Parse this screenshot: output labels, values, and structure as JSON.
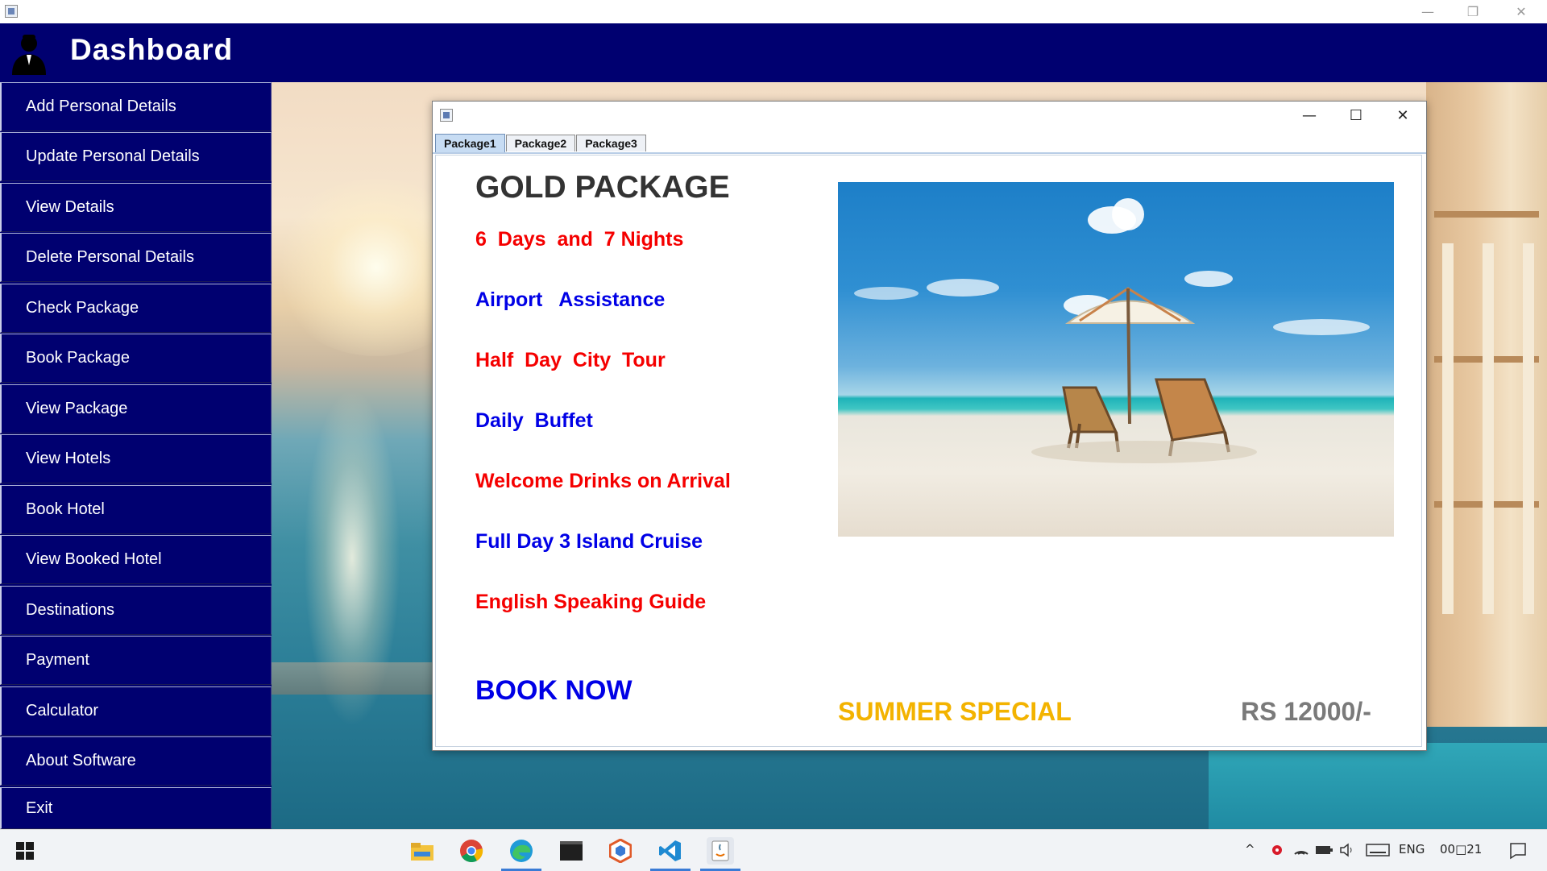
{
  "window": {
    "controls": {
      "minimize": "—",
      "restore": "❐",
      "close": "✕"
    }
  },
  "header": {
    "title": "Dashboard",
    "avatar_icon": "user-avatar-icon"
  },
  "sidebar": {
    "items": [
      {
        "label": "Add Personal Details"
      },
      {
        "label": "Update Personal Details"
      },
      {
        "label": "View Details"
      },
      {
        "label": "Delete Personal Details"
      },
      {
        "label": "Check Package"
      },
      {
        "label": "Book Package"
      },
      {
        "label": "View Package"
      },
      {
        "label": "View Hotels"
      },
      {
        "label": "Book Hotel"
      },
      {
        "label": "View Booked Hotel"
      },
      {
        "label": "Destinations"
      },
      {
        "label": "Payment"
      },
      {
        "label": "Calculator"
      },
      {
        "label": "About Software"
      },
      {
        "label": "Exit"
      }
    ],
    "bg_color": "#000070"
  },
  "package_window": {
    "controls": {
      "minimize": "—",
      "maximize": "☐",
      "close": "✕"
    },
    "tabs": [
      {
        "label": "Package1",
        "active": true
      },
      {
        "label": "Package2",
        "active": false
      },
      {
        "label": "Package3",
        "active": false
      }
    ],
    "title": "GOLD PACKAGE",
    "features": [
      {
        "text": "6  Days  and  7 Nights",
        "color": "red"
      },
      {
        "text": "Airport   Assistance",
        "color": "blue"
      },
      {
        "text": "Half  Day  City  Tour",
        "color": "red"
      },
      {
        "text": "Daily  Buffet",
        "color": "blue"
      },
      {
        "text": "Welcome Drinks on Arrival",
        "color": "red"
      },
      {
        "text": "Full Day 3 Island Cruise",
        "color": "blue"
      },
      {
        "text": "English Speaking Guide",
        "color": "red"
      }
    ],
    "book_button": "BOOK NOW",
    "promo": "SUMMER SPECIAL",
    "price": "RS 12000/-",
    "image": "beach-umbrella-image"
  },
  "taskbar": {
    "apps": [
      "file-explorer-icon",
      "chrome-icon",
      "edge-icon",
      "terminal-icon",
      "app-cube-icon",
      "vscode-icon",
      "java-app-icon"
    ],
    "tray": {
      "language": "ENG",
      "time": "00□21"
    }
  }
}
